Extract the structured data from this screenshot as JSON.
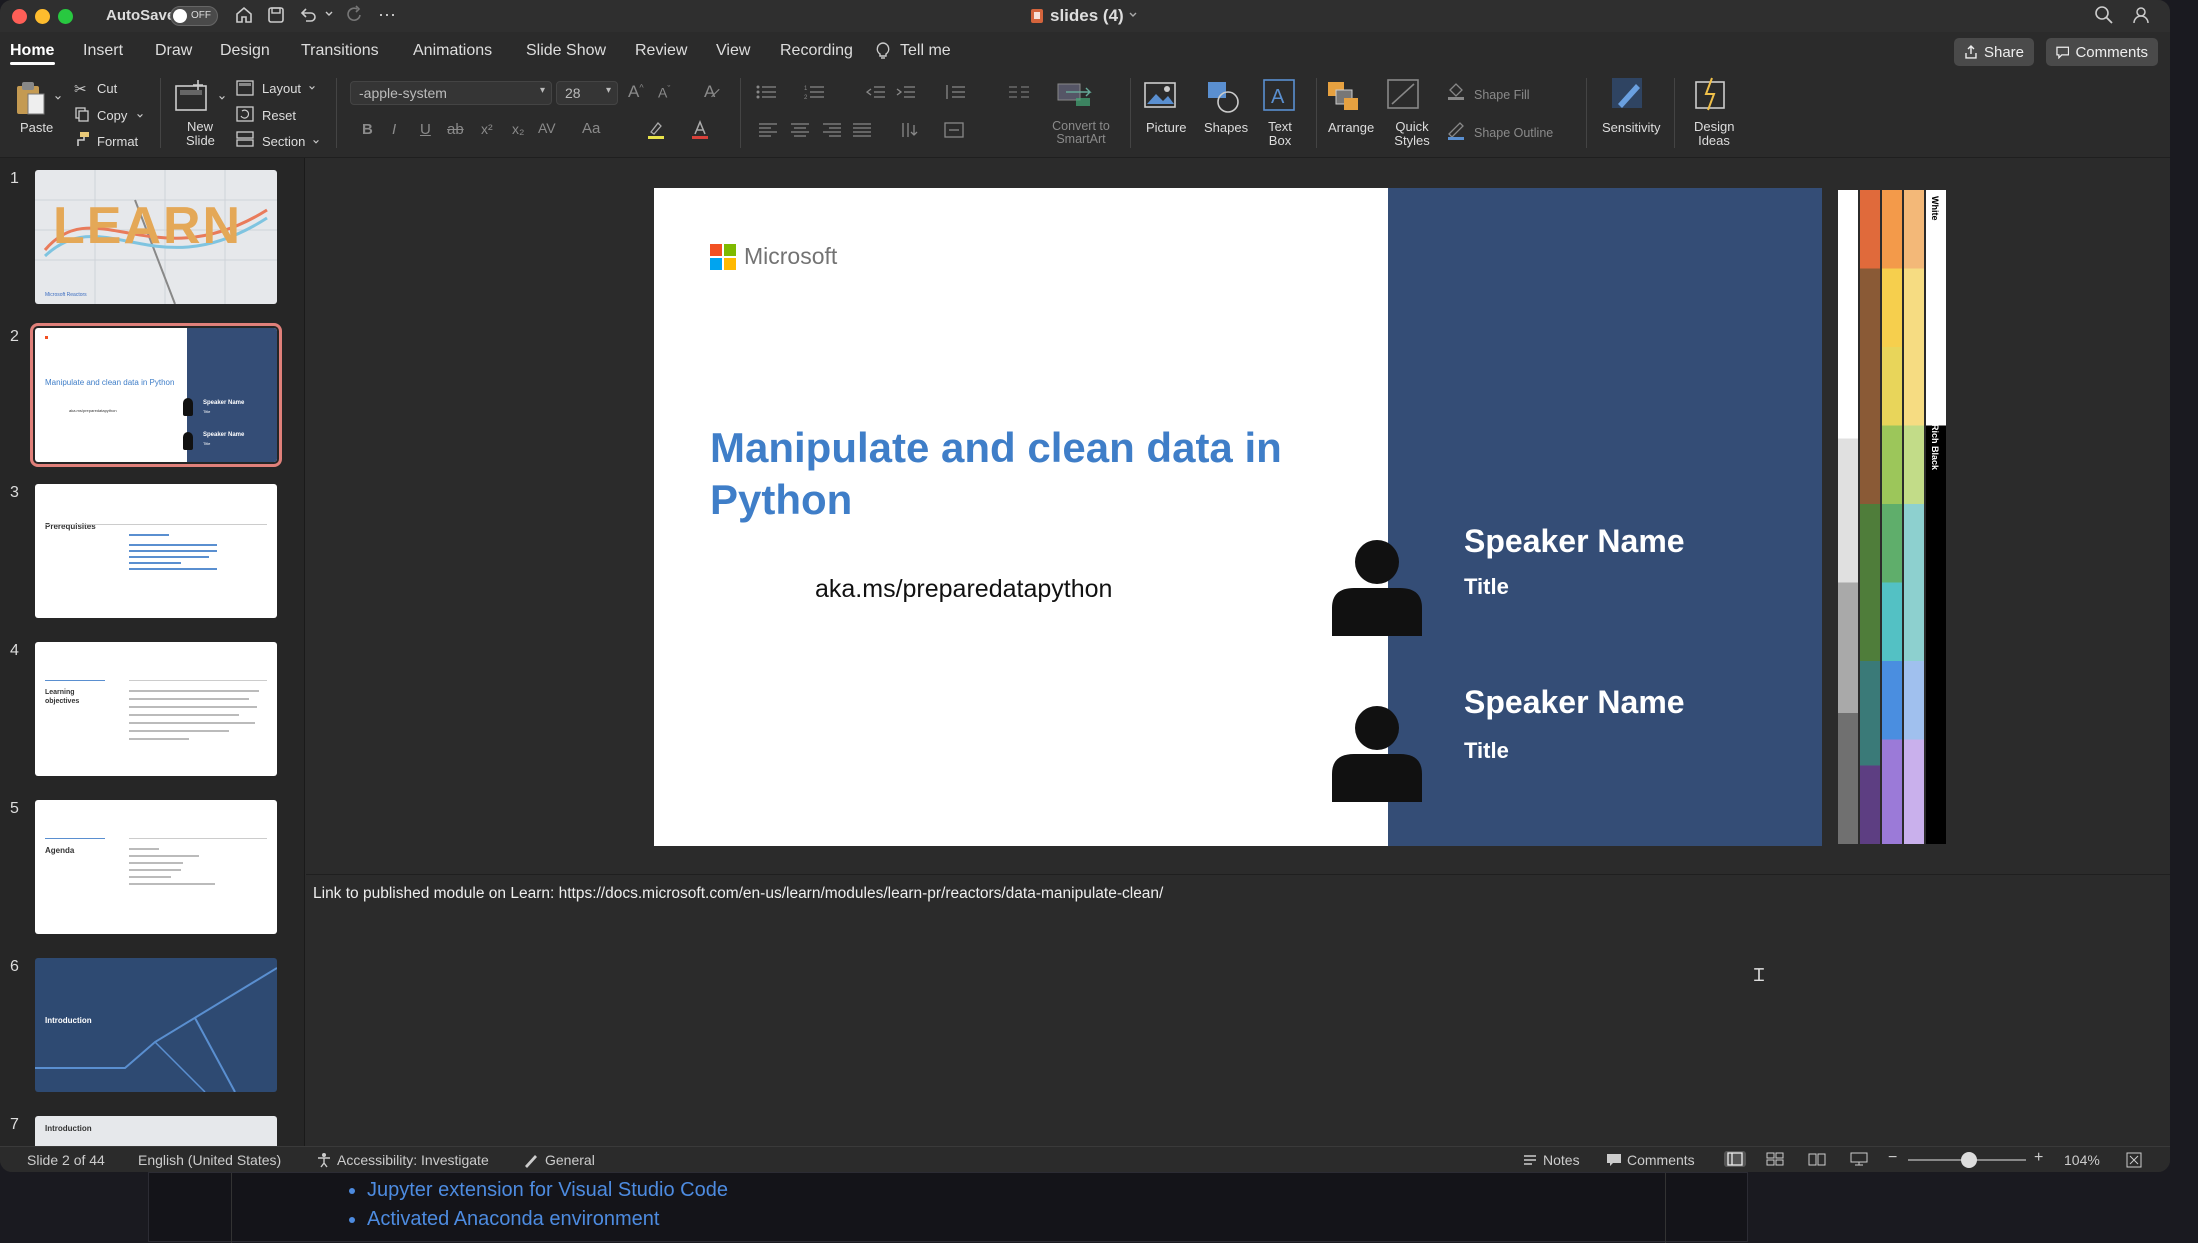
{
  "titlebar": {
    "autosave_label": "AutoSave",
    "autosave_state": "OFF",
    "doc_title": "slides (4)"
  },
  "tabs": [
    "Home",
    "Insert",
    "Draw",
    "Design",
    "Transitions",
    "Animations",
    "Slide Show",
    "Review",
    "View",
    "Recording"
  ],
  "tell_me": "Tell me",
  "share_label": "Share",
  "comments_label": "Comments",
  "ribbon": {
    "paste": "Paste",
    "cut": "Cut",
    "copy": "Copy",
    "format": "Format",
    "new_slide": "New Slide",
    "layout": "Layout",
    "reset": "Reset",
    "section": "Section",
    "font_name": "-apple-system",
    "font_size": "28",
    "convert_smartart": "Convert to SmartArt",
    "picture": "Picture",
    "shapes": "Shapes",
    "text_box": "Text Box",
    "arrange": "Arrange",
    "quick_styles": "Quick Styles",
    "shape_fill": "Shape Fill",
    "shape_outline": "Shape Outline",
    "sensitivity": "Sensitivity",
    "design_ideas": "Design Ideas"
  },
  "thumbnails": [
    {
      "num": "1",
      "text": "LEARN",
      "footer": "Microsoft Reactors"
    },
    {
      "num": "2",
      "text": "Manipulate and clean data in Python",
      "sub": "aka.ms/preparedatapython",
      "speaker": "Speaker Name",
      "role": "Title"
    },
    {
      "num": "3",
      "text": "Prerequisites"
    },
    {
      "num": "4",
      "text": "Learning objectives"
    },
    {
      "num": "5",
      "text": "Agenda"
    },
    {
      "num": "6",
      "text": "Introduction"
    },
    {
      "num": "7",
      "text": "Introduction"
    }
  ],
  "slide": {
    "logo_text": "Microsoft",
    "title": "Manipulate and clean data in Python",
    "link": "aka.ms/preparedatapython",
    "speakers": [
      {
        "name": "Speaker Name",
        "title": "Title"
      },
      {
        "name": "Speaker Name",
        "title": "Title"
      }
    ]
  },
  "swatch_labels": {
    "white": "White",
    "rich_black": "Rich Black"
  },
  "colors": {
    "slide_blue": "#344d76",
    "title_blue": "#3f7ec8",
    "ms_red": "#f25022",
    "ms_green": "#7fba00",
    "ms_blue": "#00a4ef",
    "ms_yellow": "#ffb900"
  },
  "notes_text": "Link to published module on Learn: https://docs.microsoft.com/en-us/learn/modules/learn-pr/reactors/data-manipulate-clean/",
  "status": {
    "slide_of": "Slide 2 of 44",
    "language": "English (United States)",
    "accessibility": "Accessibility: Investigate",
    "sensitivity": "General",
    "notes": "Notes",
    "comments": "Comments",
    "zoom": "104%"
  },
  "background_doc": {
    "items": [
      "Jupyter extension for Visual Studio Code",
      "Activated Anaconda environment"
    ]
  }
}
